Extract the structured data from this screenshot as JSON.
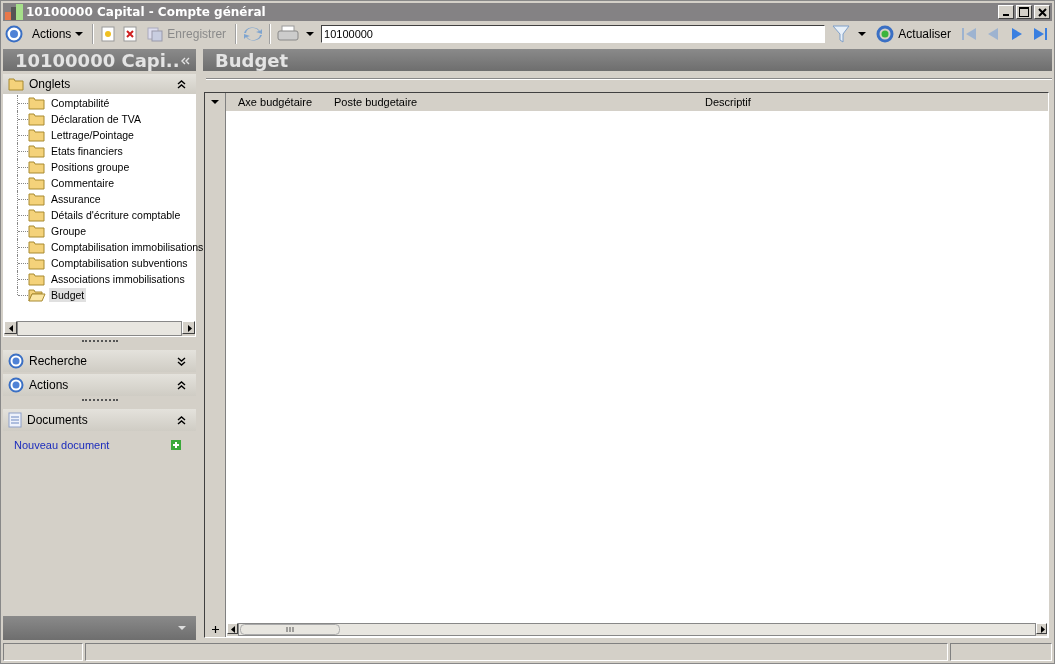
{
  "window": {
    "title": "10100000 Capital -  Compte général"
  },
  "toolbar": {
    "actions_menu": "Actions",
    "save": "Enregistrer",
    "save_disabled": true,
    "search_value": "10100000",
    "refresh": "Actualiser",
    "first_disabled": true,
    "previous_disabled": true
  },
  "left_panel": {
    "title": "10100000 Capi..",
    "tabs_section": {
      "title": "Onglets",
      "expanded": true,
      "items": [
        {
          "label": "Comptabilité",
          "selected": false
        },
        {
          "label": "Déclaration de TVA",
          "selected": false
        },
        {
          "label": "Lettrage/Pointage",
          "selected": false
        },
        {
          "label": "Etats financiers",
          "selected": false
        },
        {
          "label": "Positions groupe",
          "selected": false
        },
        {
          "label": "Commentaire",
          "selected": false
        },
        {
          "label": "Assurance",
          "selected": false
        },
        {
          "label": "Détails d'écriture comptable",
          "selected": false
        },
        {
          "label": "Groupe",
          "selected": false
        },
        {
          "label": "Comptabilisation immobilisations",
          "selected": false
        },
        {
          "label": "Comptabilisation subventions",
          "selected": false
        },
        {
          "label": "Associations immobilisations",
          "selected": false
        },
        {
          "label": "Budget",
          "selected": true
        }
      ]
    },
    "sections": [
      {
        "title": "Recherche",
        "kind": "circle",
        "expanded": false
      },
      {
        "title": "Actions",
        "kind": "circle",
        "expanded": true
      },
      {
        "title": "Documents",
        "kind": "document",
        "expanded": true
      }
    ],
    "documents_link": "Nouveau document"
  },
  "main": {
    "title": "Budget",
    "table": {
      "columns": [
        "Axe budgétaire",
        "Poste budgetaire",
        "Descriptif"
      ]
    }
  }
}
